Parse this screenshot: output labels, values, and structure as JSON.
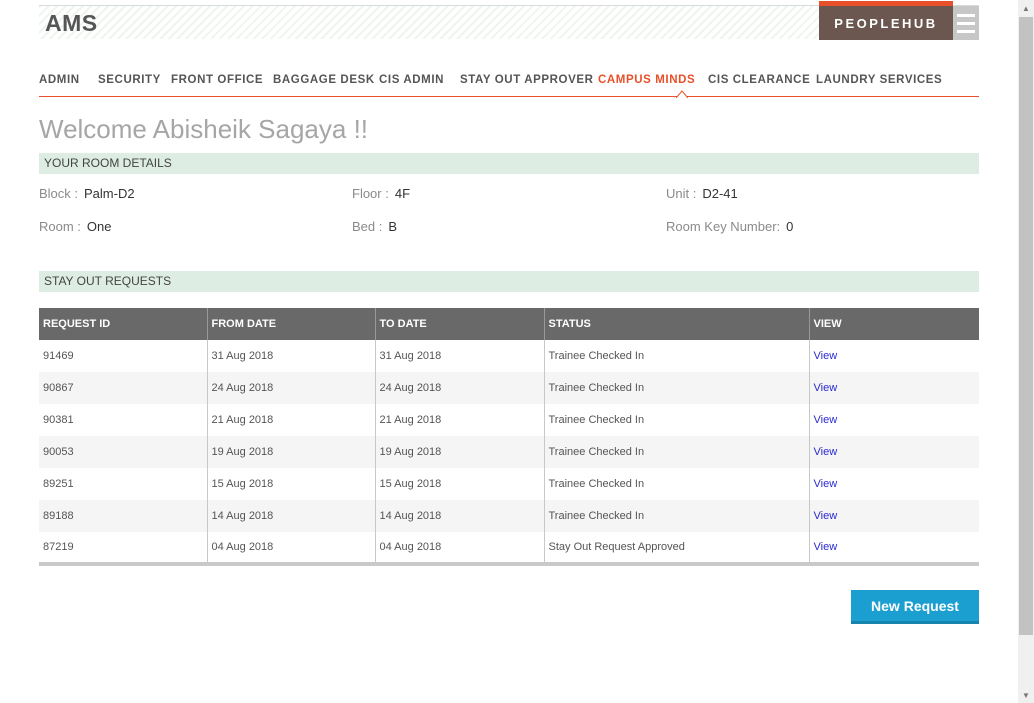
{
  "header": {
    "logo": "AMS",
    "peoplehub_label": "PEOPLEHUB"
  },
  "nav": {
    "items": [
      {
        "label": "ADMIN",
        "active": false
      },
      {
        "label": "SECURITY",
        "active": false
      },
      {
        "label": "FRONT OFFICE",
        "active": false
      },
      {
        "label": "BAGGAGE DESK",
        "active": false
      },
      {
        "label": "CIS ADMIN",
        "active": false
      },
      {
        "label": "STAY OUT APPROVER",
        "active": false
      },
      {
        "label": "CAMPUS MINDS",
        "active": true
      },
      {
        "label": "CIS CLEARANCE",
        "active": false
      },
      {
        "label": "LAUNDRY SERVICES",
        "active": false
      }
    ]
  },
  "welcome": "Welcome Abisheik Sagaya !!",
  "room_details": {
    "title": "YOUR ROOM DETAILS",
    "block_label": "Block :",
    "block_value": "Palm-D2",
    "floor_label": "Floor :",
    "floor_value": "4F",
    "unit_label": "Unit :",
    "unit_value": "D2-41",
    "room_label": "Room :",
    "room_value": "One",
    "bed_label": "Bed :",
    "bed_value": "B",
    "key_label": "Room Key Number:",
    "key_value": "0"
  },
  "requests": {
    "title": "STAY OUT REQUESTS",
    "columns": [
      "REQUEST ID",
      "FROM DATE",
      "TO DATE",
      "STATUS",
      "VIEW"
    ],
    "rows": [
      {
        "id": "91469",
        "from": "31 Aug 2018",
        "to": "31 Aug 2018",
        "status": "Trainee Checked In",
        "view": "View"
      },
      {
        "id": "90867",
        "from": "24 Aug 2018",
        "to": "24 Aug 2018",
        "status": "Trainee Checked In",
        "view": "View"
      },
      {
        "id": "90381",
        "from": "21 Aug 2018",
        "to": "21 Aug 2018",
        "status": "Trainee Checked In",
        "view": "View"
      },
      {
        "id": "90053",
        "from": "19 Aug 2018",
        "to": "19 Aug 2018",
        "status": "Trainee Checked In",
        "view": "View"
      },
      {
        "id": "89251",
        "from": "15 Aug 2018",
        "to": "15 Aug 2018",
        "status": "Trainee Checked In",
        "view": "View"
      },
      {
        "id": "89188",
        "from": "14 Aug 2018",
        "to": "14 Aug 2018",
        "status": "Trainee Checked In",
        "view": "View"
      },
      {
        "id": "87219",
        "from": "04 Aug 2018",
        "to": "04 Aug 2018",
        "status": "Stay Out Request Approved",
        "view": "View"
      }
    ]
  },
  "new_request_label": "New Request",
  "colors": {
    "accent": "#e8502a",
    "peoplehub_bg": "#6b5750",
    "section_bg": "#deede4",
    "table_header_bg": "#696969",
    "link": "#2a2ad0",
    "button": "#1b9fd1"
  },
  "icons": {
    "menu": "hamburger-menu-icon",
    "scroll_up": "arrow-up-icon",
    "scroll_down": "arrow-down-icon"
  }
}
